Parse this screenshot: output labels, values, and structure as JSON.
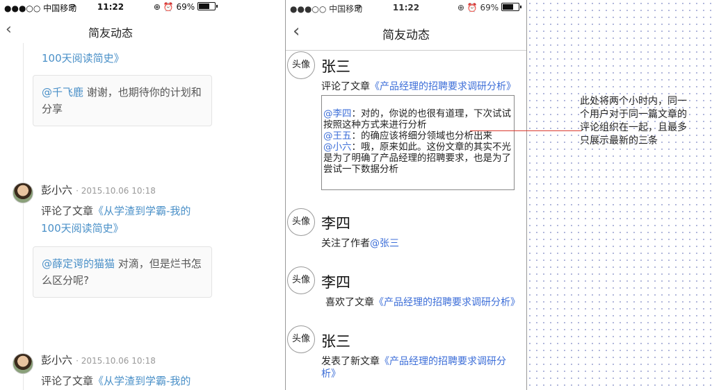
{
  "left": {
    "status": {
      "carrier": "●●●○○ 中国移动",
      "wifi": "wifi-icon",
      "time": "11:22",
      "right": "⊕ ⏰ 69%"
    },
    "nav": {
      "title": "简友动态",
      "back_icon": "chevron-left-icon"
    },
    "feed": [
      {
        "top_partial": "100天阅读简史》",
        "quote_user": "@千飞鹿",
        "quote_text": " 谢谢，也期待你的计划和分享"
      },
      {
        "user": "彭小六",
        "time": "· 2015.10.06 10:18",
        "action": "评论了文章",
        "article": "《从学渣到学霸-我的100天阅读简史》",
        "quote_user": "@薛定谔的猫猫",
        "quote_text": " 对滴，但是烂书怎么区分呢?"
      },
      {
        "user": "彭小六",
        "time": "· 2015.10.06 10:18",
        "action": "评论了文章",
        "article": "《从学渣到学霸-我的"
      }
    ]
  },
  "mid": {
    "status": {
      "carrier": "●●●○○ 中国移动",
      "wifi": "wifi-icon",
      "time": "11:22",
      "right": "⊕ ⏰ 69%"
    },
    "nav": {
      "title": "简友动态",
      "back_icon": "chevron-left-icon"
    },
    "avatar_label": "头像",
    "items": [
      {
        "name": "张三",
        "action": "评论了文章",
        "article": "《产品经理的招聘要求调研分析》",
        "comments": [
          {
            "user": "@李四",
            "text": "：对的，你说的也很有道理，下次试试按照这种方式来进行分析"
          },
          {
            "user": "@王五",
            "text": "：的确应该将细分领域也分析出来"
          },
          {
            "user": "@小六",
            "text": "：哦，原来如此。这份文章的其实不光是为了明确了产品经理的招聘要求，也是为了尝试一下数据分析"
          }
        ]
      },
      {
        "name": "李四",
        "action": "关注了作者",
        "target": "@张三"
      },
      {
        "name": "李四",
        "action": "喜欢了文章",
        "article": "《产品经理的招聘要求调研分析》"
      },
      {
        "name": "张三",
        "action": "发表了新文章",
        "article": "《产品经理的招聘要求调研分析》"
      }
    ]
  },
  "annotation": {
    "note": "此处将两个小时内，同一个用户对于同一篇文章的评论组织在一起，且最多只展示最新的三条",
    "line_color": "#d9382c"
  }
}
